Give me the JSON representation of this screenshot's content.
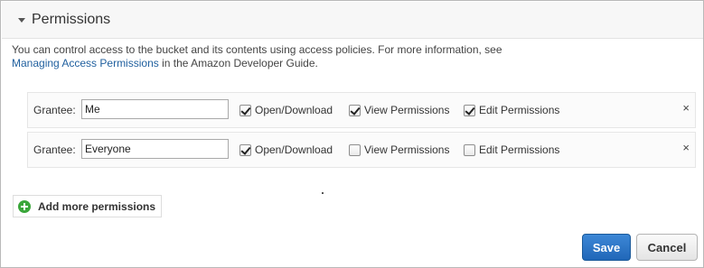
{
  "header": {
    "title": "Permissions",
    "caret_icon": "caret-down-icon"
  },
  "description": {
    "text_before": "You can control access to the bucket and its contents using access policies. For more information, see",
    "link": "Managing Access Permissions",
    "text_after": " in the Amazon Developer Guide."
  },
  "grantees": [
    {
      "label": "Grantee:",
      "value": "Me",
      "permissions": [
        {
          "label": "Open/Download",
          "checked": true
        },
        {
          "label": "View Permissions",
          "checked": true
        },
        {
          "label": "Edit Permissions",
          "checked": true
        }
      ],
      "remove": "×"
    },
    {
      "label": "Grantee:",
      "value": "Everyone",
      "permissions": [
        {
          "label": "Open/Download",
          "checked": true
        },
        {
          "label": "View Permissions",
          "checked": false
        },
        {
          "label": "Edit Permissions",
          "checked": false
        }
      ],
      "remove": "×"
    }
  ],
  "add_more": {
    "label": "Add more permissions",
    "icon": "add-circle-icon"
  },
  "actions": {
    "save_label": "Save",
    "cancel_label": "Cancel"
  },
  "colors": {
    "accent": "#2a74c6",
    "add_icon": "#3aa63a",
    "link": "#1f5f9e"
  }
}
